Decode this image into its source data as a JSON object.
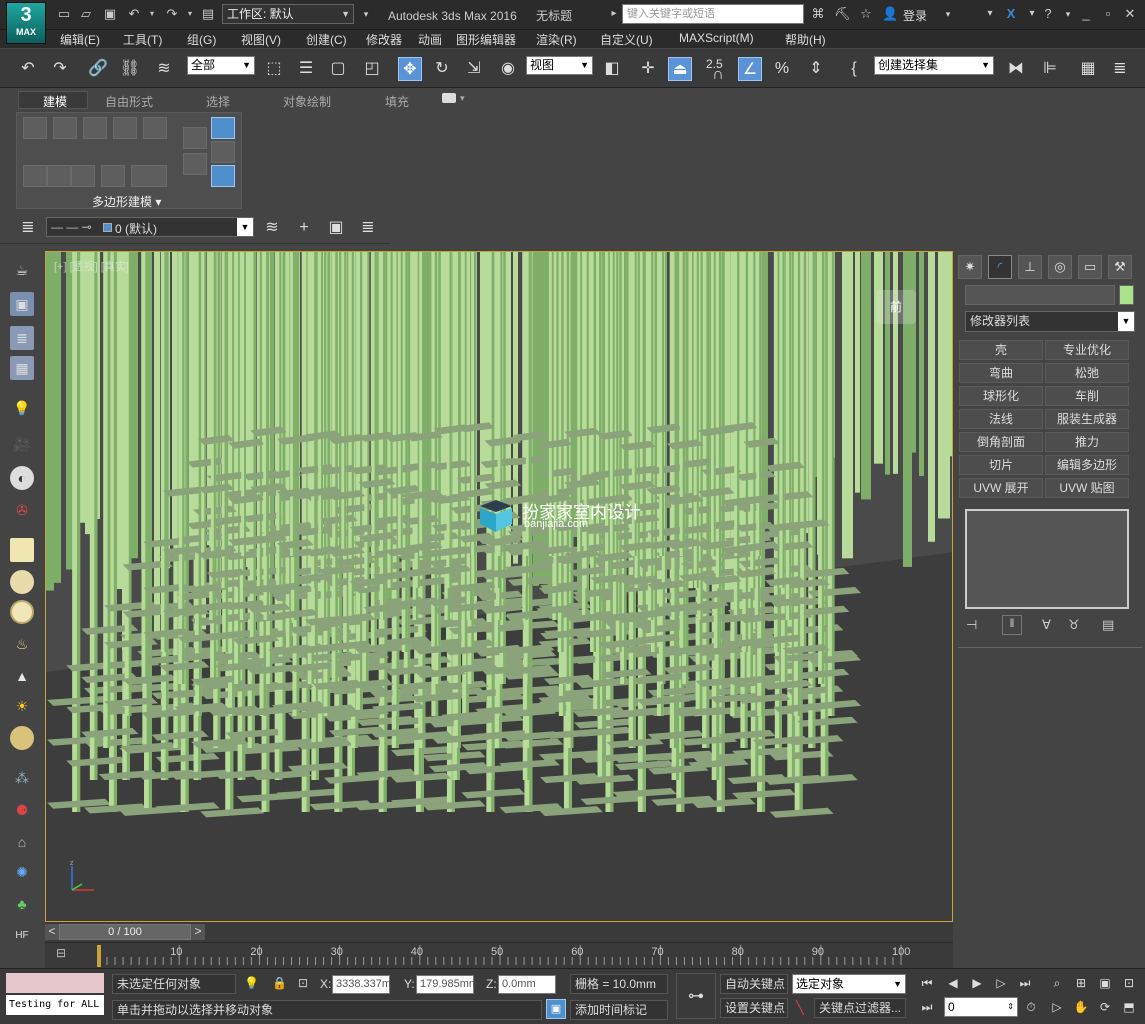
{
  "app": {
    "title": "Autodesk 3ds Max 2016",
    "doc": "无标题",
    "logo": "MAX",
    "search_placeholder": "键入关键字或短语",
    "login": "登录"
  },
  "workspace": {
    "label": "工作区: 默认"
  },
  "menus": [
    "编辑(E)",
    "工具(T)",
    "组(G)",
    "视图(V)",
    "创建(C)",
    "修改器",
    "动画",
    "图形编辑器",
    "渲染(R)",
    "自定义(U)",
    "MAXScript(M)",
    "帮助(H)"
  ],
  "toolbar": {
    "selection_filter": "全部",
    "ref_coord": "视图",
    "snap_value": "2.5",
    "named_selection": "创建选择集"
  },
  "ribbon": {
    "tabs": [
      "建模",
      "自由形式",
      "选择",
      "对象绘制",
      "填充"
    ],
    "panel_label": "多边形建模 ▾"
  },
  "layer": {
    "current": "0 (默认)"
  },
  "viewport": {
    "label": "[+] [透视] [真实]",
    "watermark_title": "扮家家室内设计",
    "watermark_url": "banjiajia.com",
    "viewcube_label": "前"
  },
  "command_panel": {
    "modifier_list": "修改器列表",
    "modifiers": [
      [
        "壳",
        "专业优化"
      ],
      [
        "弯曲",
        "松弛"
      ],
      [
        "球形化",
        "车削"
      ],
      [
        "法线",
        "服装生成器"
      ],
      [
        "倒角剖面",
        "推力"
      ],
      [
        "切片",
        "编辑多边形"
      ],
      [
        "UVW 展开",
        "UVW 贴图"
      ]
    ],
    "object_color": "#a8e28a"
  },
  "timeline": {
    "frame": "0 / 100",
    "prev": "<",
    "next": ">",
    "ticks": [
      "10",
      "20",
      "30",
      "40",
      "50",
      "60",
      "70",
      "80",
      "90",
      "100"
    ]
  },
  "status": {
    "script_listener": "Testing for ALL",
    "selection": "未选定任何对象",
    "prompt": "单击并拖动以选择并移动对象",
    "x_label": "X:",
    "x_value": "3338.337m",
    "y_label": "Y:",
    "y_value": "179.985mn",
    "z_label": "Z:",
    "z_value": "0.0mm",
    "grid": "栅格 = 10.0mm",
    "auto_key": "自动关键点",
    "set_key": "设置关键点",
    "key_mode": "选定对象",
    "key_filter": "关键点过滤器...",
    "add_time_tag": "添加时间标记",
    "current_frame": "0"
  },
  "colors": {
    "accent": "#5a93d6",
    "viewport_border": "#c9a23a",
    "stick": "#b7dc9a",
    "stick_dark": "#7fae69",
    "plate": "#8aa37a"
  }
}
